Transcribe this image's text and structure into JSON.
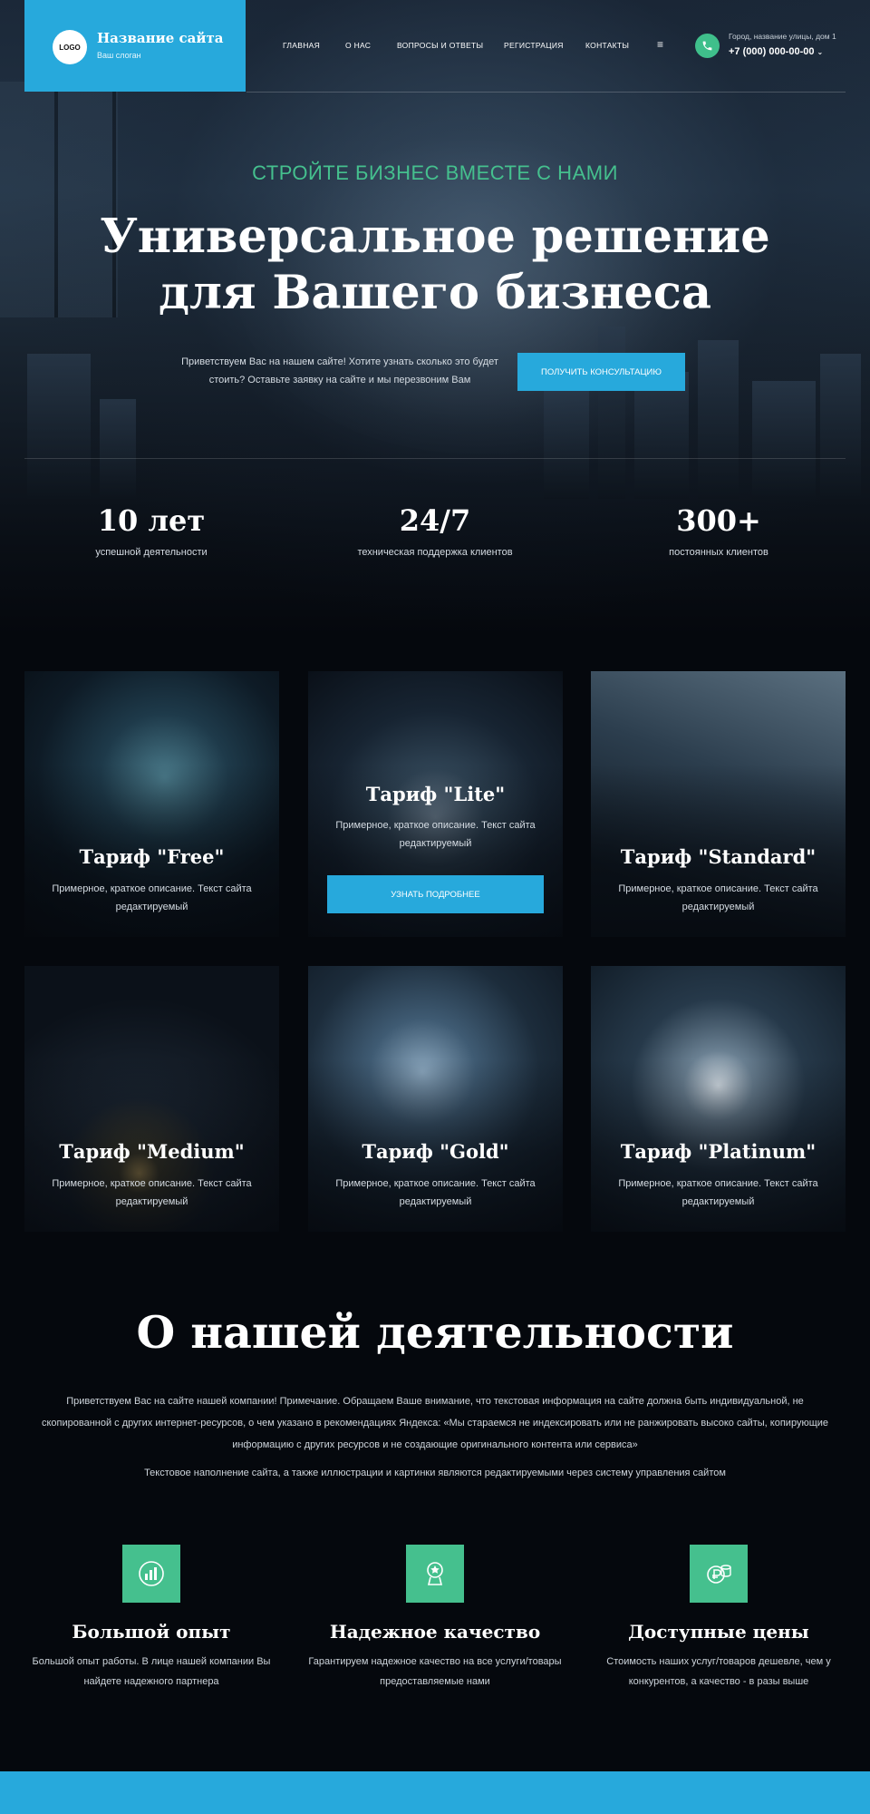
{
  "header": {
    "logo_text": "LOGO",
    "site_name": "Название сайта",
    "slogan": "Ваш слоган",
    "nav": [
      "ГЛАВНАЯ",
      "О НАС",
      "ВОПРОСЫ И ОТВЕТЫ",
      "РЕГИСТРАЦИЯ",
      "КОНТАКТЫ"
    ],
    "menu_icon": "menu-icon",
    "address": "Город, название улицы, дом 1",
    "phone": "+7 (000) 000-00-00",
    "phone_icon": "phone-icon",
    "accent_color": "#27a9dc",
    "green_color": "#45c08e"
  },
  "hero": {
    "kicker": "СТРОЙТЕ БИЗНЕС ВМЕСТЕ С НАМИ",
    "title_line1": "Универсальное решение",
    "title_line2": "для Вашего бизнеса",
    "text": "Приветствуем Вас на нашем сайте! Хотите узнать сколько это будет стоить? Оставьте заявку на сайте и мы перезвоним Вам",
    "cta": "ПОЛУЧИТЬ КОНСУЛЬТАЦИЮ"
  },
  "stats": [
    {
      "num": "10 лет",
      "label": "успешной деятельности"
    },
    {
      "num": "24/7",
      "label": "техническая поддержка клиентов"
    },
    {
      "num": "300+",
      "label": "постоянных клиентов"
    }
  ],
  "cards": [
    {
      "title": "Тариф \"Free\"",
      "desc": "Примерное, краткое описание. Текст сайта редактируемый"
    },
    {
      "title": "Тариф \"Lite\"",
      "desc": "Примерное, краткое описание. Текст сайта редактируемый",
      "button": "УЗНАТЬ ПОДРОБНЕЕ"
    },
    {
      "title": "Тариф \"Standard\"",
      "desc": "Примерное, краткое описание. Текст сайта редактируемый"
    },
    {
      "title": "Тариф \"Medium\"",
      "desc": "Примерное, краткое описание. Текст сайта редактируемый"
    },
    {
      "title": "Тариф \"Gold\"",
      "desc": "Примерное, краткое описание. Текст сайта редактируемый"
    },
    {
      "title": "Тариф \"Platinum\"",
      "desc": "Примерное, краткое описание. Текст сайта редактируемый"
    }
  ],
  "about": {
    "title": "О нашей деятельности",
    "p1": "Приветствуем Вас на сайте нашей компании! Примечание. Обращаем Ваше внимание, что текстовая информация на сайте должна быть индивидуальной, не скопированной с других интернет-ресурсов, о чем указано в рекомендациях Яндекса: «Мы стараемся не индексировать или не ранжировать высоко сайты, копирующие информацию с других ресурсов и не создающие оригинального контента или сервиса»",
    "p2": "Текстовое наполнение сайта, а также иллюстрации и картинки являются редактируемыми через систему управления сайтом"
  },
  "features": [
    {
      "icon": "growth-chart-icon",
      "title": "Большой опыт",
      "desc": "Большой опыт работы. В лице нашей компании Вы найдете надежного партнера"
    },
    {
      "icon": "award-icon",
      "title": "Надежное качество",
      "desc": "Гарантируем надежное качество на все услуги/товары предоставляемые нами"
    },
    {
      "icon": "ruble-coins-icon",
      "title": "Доступные цены",
      "desc": "Стоимость наших услуг/товаров дешевле, чем у конкурентов, а качество - в разы выше"
    }
  ]
}
